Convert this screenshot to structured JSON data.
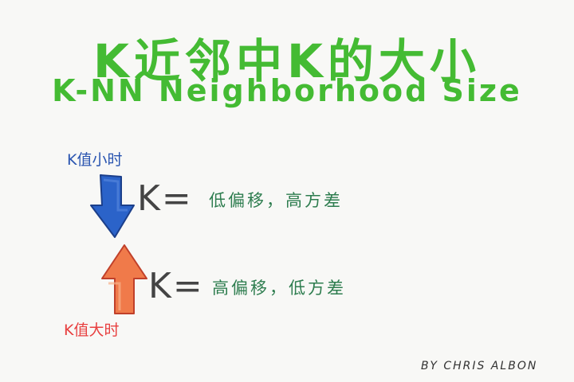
{
  "title": {
    "zh": "K近邻中K的大小",
    "en": "K-NN Neighborhood Size"
  },
  "small_k": {
    "label": "K值小时",
    "equation": "K=",
    "description": "低偏移，高方差"
  },
  "large_k": {
    "label": "K值大时",
    "equation": "K=",
    "description": "高偏移，低方差"
  },
  "byline": "BY CHRIS ALBON",
  "colors": {
    "title": "#44bb33",
    "small_label": "#2a55b0",
    "large_label": "#e84040",
    "description": "#2e7d4f",
    "down_arrow": "#2b63c9",
    "up_arrow": "#f07a4a"
  },
  "icons": {
    "down": "down-arrow-icon",
    "up": "up-arrow-icon"
  }
}
